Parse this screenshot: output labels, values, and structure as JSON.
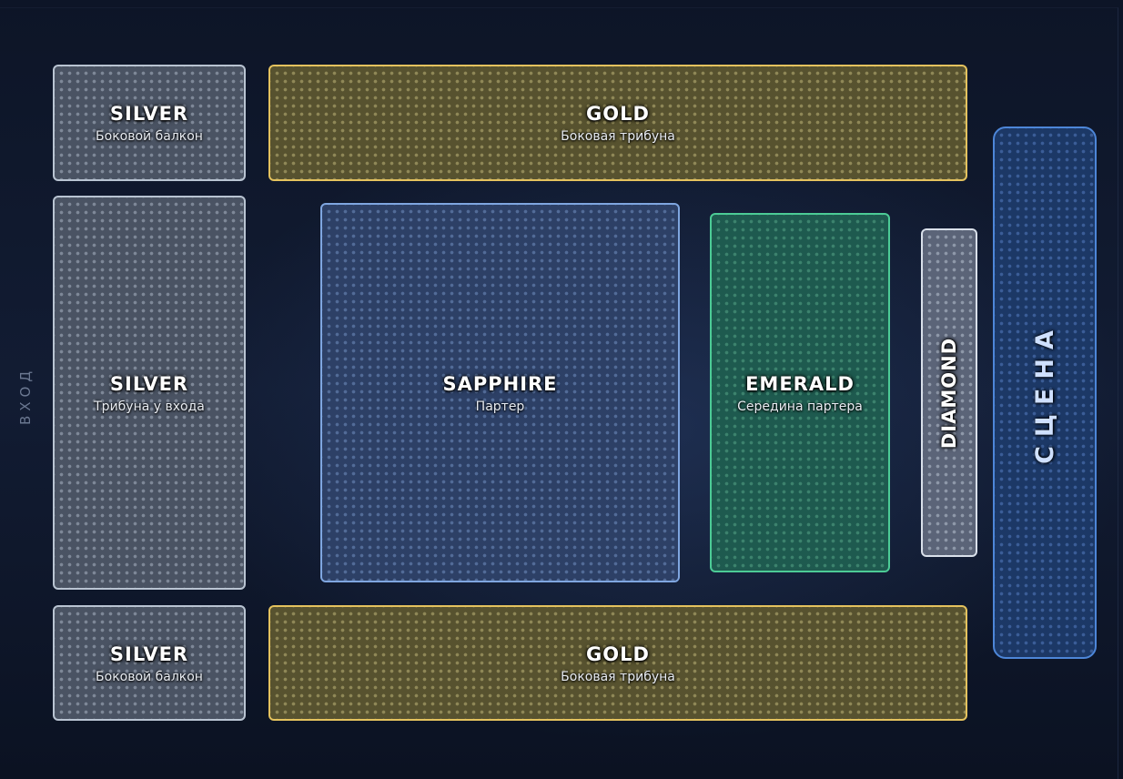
{
  "entrance": {
    "label": "ВХОД"
  },
  "stage": {
    "label": "СЦЕНА"
  },
  "sections": [
    {
      "id": "silver-top",
      "tier": "SILVER",
      "name": "Боковой балкон",
      "color": "#b9c4d2"
    },
    {
      "id": "gold-top",
      "tier": "GOLD",
      "name": "Боковая трибуна",
      "color": "#e4c25e"
    },
    {
      "id": "silver-mid",
      "tier": "SILVER",
      "name": "Трибуна у входа",
      "color": "#b9c4d2"
    },
    {
      "id": "sapphire",
      "tier": "SAPPHIRE",
      "name": "Партер",
      "color": "#7fa6e0"
    },
    {
      "id": "emerald",
      "tier": "EMERALD",
      "name": "Середина партера",
      "color": "#4ccb96"
    },
    {
      "id": "diamond",
      "tier": "DIAMOND",
      "name": "",
      "color": "#d9e0ea"
    },
    {
      "id": "silver-bottom",
      "tier": "SILVER",
      "name": "Боковой балкон",
      "color": "#b9c4d2"
    },
    {
      "id": "gold-bottom",
      "tier": "GOLD",
      "name": "Боковая трибуна",
      "color": "#e4c25e"
    }
  ]
}
